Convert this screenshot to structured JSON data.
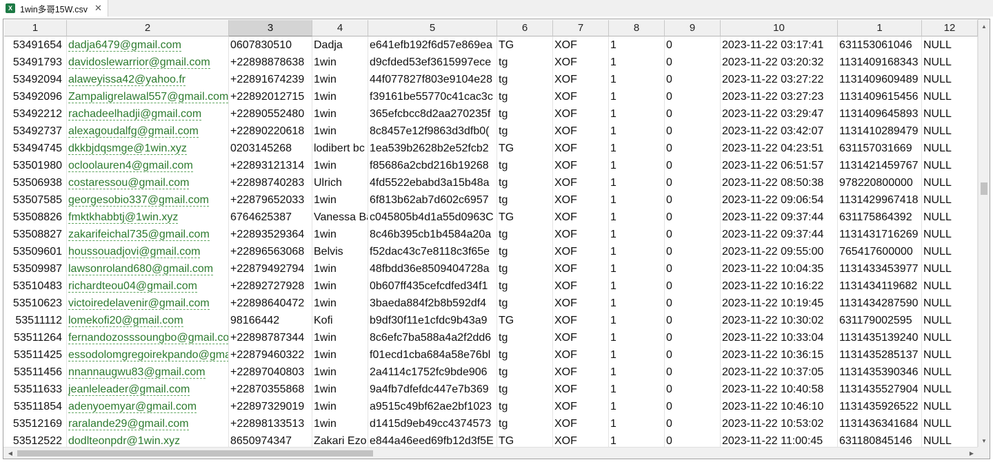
{
  "tab": {
    "icon_text": "X",
    "title": "1win多哥15W.csv",
    "close_label": "✕"
  },
  "columns": [
    {
      "label": "1",
      "selected": false
    },
    {
      "label": "2",
      "selected": false
    },
    {
      "label": "3",
      "selected": true
    },
    {
      "label": "4",
      "selected": false
    },
    {
      "label": "5",
      "selected": false
    },
    {
      "label": "6",
      "selected": false
    },
    {
      "label": "7",
      "selected": false
    },
    {
      "label": "8",
      "selected": false
    },
    {
      "label": "9",
      "selected": false
    },
    {
      "label": "10",
      "selected": false
    },
    {
      "label": "1",
      "selected": false
    },
    {
      "label": "12",
      "selected": false
    }
  ],
  "rows": [
    [
      "53491654",
      "dadja6479@gmail.com",
      "0607830510",
      "Dadja",
      "e641efb192f6d57e869ea",
      "TG",
      "XOF",
      "1",
      "0",
      "2023-11-22 03:17:41",
      "631153061046",
      "NULL"
    ],
    [
      "53491793",
      "davidoslewarrior@gmail.com",
      "+22898878638",
      "1win",
      "d9cfded53ef3615997ece",
      "tg",
      "XOF",
      "1",
      "0",
      "2023-11-22 03:20:32",
      "1131409168343",
      "NULL"
    ],
    [
      "53492094",
      "alaweyissa42@yahoo.fr",
      "+22891674239",
      "1win",
      "44f077827f803e9104e28",
      "tg",
      "XOF",
      "1",
      "0",
      "2023-11-22 03:27:22",
      "1131409609489",
      "NULL"
    ],
    [
      "53492096",
      "Zampaligrelawal557@gmail.com",
      "+22892012715",
      "1win",
      "f39161be55770c41cac3c",
      "tg",
      "XOF",
      "1",
      "0",
      "2023-11-22 03:27:23",
      "1131409615456",
      "NULL"
    ],
    [
      "53492212",
      "rachadeelhadji@gmail.com",
      "+22890552480",
      "1win",
      "365efcbcc8d2aa270235f",
      "tg",
      "XOF",
      "1",
      "0",
      "2023-11-22 03:29:47",
      "1131409645893",
      "NULL"
    ],
    [
      "53492737",
      "alexagoudalfg@gmail.com",
      "+22890220618",
      "1win",
      "8c8457e12f9863d3dfb0(",
      "tg",
      "XOF",
      "1",
      "0",
      "2023-11-22 03:42:07",
      "1131410289479",
      "NULL"
    ],
    [
      "53494745",
      "dkkbjdqsmge@1win.xyz",
      "0203145268",
      "lodibert bc",
      "1ea539b2628b2e52fcb2",
      "TG",
      "XOF",
      "1",
      "0",
      "2023-11-22 04:23:51",
      "631157031669",
      "NULL"
    ],
    [
      "53501980",
      "ocloolauren4@gmail.com",
      "+22893121314",
      "1win",
      "f85686a2cbd216b19268",
      "tg",
      "XOF",
      "1",
      "0",
      "2023-11-22 06:51:57",
      "1131421459767",
      "NULL"
    ],
    [
      "53506938",
      "costaressou@gmail.com",
      "+22898740283",
      "Ulrich",
      "4fd5522ebabd3a15b48a",
      "tg",
      "XOF",
      "1",
      "0",
      "2023-11-22 08:50:38",
      "978220800000",
      "NULL"
    ],
    [
      "53507585",
      "georgesobio337@gmail.com",
      "+22879652033",
      "1win",
      "6f813b62ab7d602c6957",
      "tg",
      "XOF",
      "1",
      "0",
      "2023-11-22 09:06:54",
      "1131429967418",
      "NULL"
    ],
    [
      "53508826",
      "fmktkhabbtj@1win.xyz",
      "6764625387",
      "Vanessa Ba",
      "c045805b4d1a55d0963C",
      "TG",
      "XOF",
      "1",
      "0",
      "2023-11-22 09:37:44",
      "631175864392",
      "NULL"
    ],
    [
      "53508827",
      "zakarifeichal735@gmail.com",
      "+22893529364",
      "1win",
      "8c46b395cb1b4584a20a",
      "tg",
      "XOF",
      "1",
      "0",
      "2023-11-22 09:37:44",
      "1131431716269",
      "NULL"
    ],
    [
      "53509601",
      "houssouadjovi@gmail.com",
      "+22896563068",
      "Belvis",
      "f52dac43c7e8118c3f65e",
      "tg",
      "XOF",
      "1",
      "0",
      "2023-11-22 09:55:00",
      "765417600000",
      "NULL"
    ],
    [
      "53509987",
      "lawsonroland680@gmail.com",
      "+22879492794",
      "1win",
      "48fbdd36e8509404728a",
      "tg",
      "XOF",
      "1",
      "0",
      "2023-11-22 10:04:35",
      "1131433453977",
      "NULL"
    ],
    [
      "53510483",
      "richardteou04@gmail.com",
      "+22892727928",
      "1win",
      "0b607ff435cefcdfed34f1",
      "tg",
      "XOF",
      "1",
      "0",
      "2023-11-22 10:16:22",
      "1131434119682",
      "NULL"
    ],
    [
      "53510623",
      "victoiredelavenir@gmail.com",
      "+22898640472",
      "1win",
      "3baeda884f2b8b592df4",
      "tg",
      "XOF",
      "1",
      "0",
      "2023-11-22 10:19:45",
      "1131434287590",
      "NULL"
    ],
    [
      "53511112",
      "lomekofi20@gmail.com",
      "98166442",
      "Kofi",
      "b9df30f11e1cfdc9b43a9",
      "TG",
      "XOF",
      "1",
      "0",
      "2023-11-22 10:30:02",
      "631179002595",
      "NULL"
    ],
    [
      "53511264",
      "fernandozosssoungbo@gmail.com",
      "+22898787344",
      "1win",
      "8c6efc7ba588a4a2f2dd6",
      "tg",
      "XOF",
      "1",
      "0",
      "2023-11-22 10:33:04",
      "1131435139240",
      "NULL"
    ],
    [
      "53511425",
      "essodolomgregoirekpando@gmail.com",
      "+22879460322",
      "1win",
      "f01ecd1cba684a58e76bl",
      "tg",
      "XOF",
      "1",
      "0",
      "2023-11-22 10:36:15",
      "1131435285137",
      "NULL"
    ],
    [
      "53511456",
      "nnannaugwu83@gmail.com",
      "+22897040803",
      "1win",
      "2a4114c1752fc9bde906",
      "tg",
      "XOF",
      "1",
      "0",
      "2023-11-22 10:37:05",
      "1131435390346",
      "NULL"
    ],
    [
      "53511633",
      "jeanleleader@gmail.com",
      "+22870355868",
      "1win",
      "9a4fb7dfefdc447e7b369",
      "tg",
      "XOF",
      "1",
      "0",
      "2023-11-22 10:40:58",
      "1131435527904",
      "NULL"
    ],
    [
      "53511854",
      "adenyoemyar@gmail.com",
      "+22897329019",
      "1win",
      "a9515c49bf62ae2bf1023",
      "tg",
      "XOF",
      "1",
      "0",
      "2023-11-22 10:46:10",
      "1131435926522",
      "NULL"
    ],
    [
      "53512169",
      "raralande29@gmail.com",
      "+22898133513",
      "1win",
      "d1415d9eb49cc4374573",
      "tg",
      "XOF",
      "1",
      "0",
      "2023-11-22 10:53:02",
      "1131436341684",
      "NULL"
    ],
    [
      "53512522",
      "dodlteonpdr@1win.xyz",
      "8650974347",
      "Zakari Ezo",
      "e844a46eed69fb12d3f5E",
      "TG",
      "XOF",
      "1",
      "0",
      "2023-11-22 11:00:45",
      "631180845146",
      "NULL"
    ]
  ],
  "scrollbars": {
    "up_arrow": "▲",
    "down_arrow": "▼",
    "left_arrow": "◀",
    "right_arrow": "▶"
  }
}
